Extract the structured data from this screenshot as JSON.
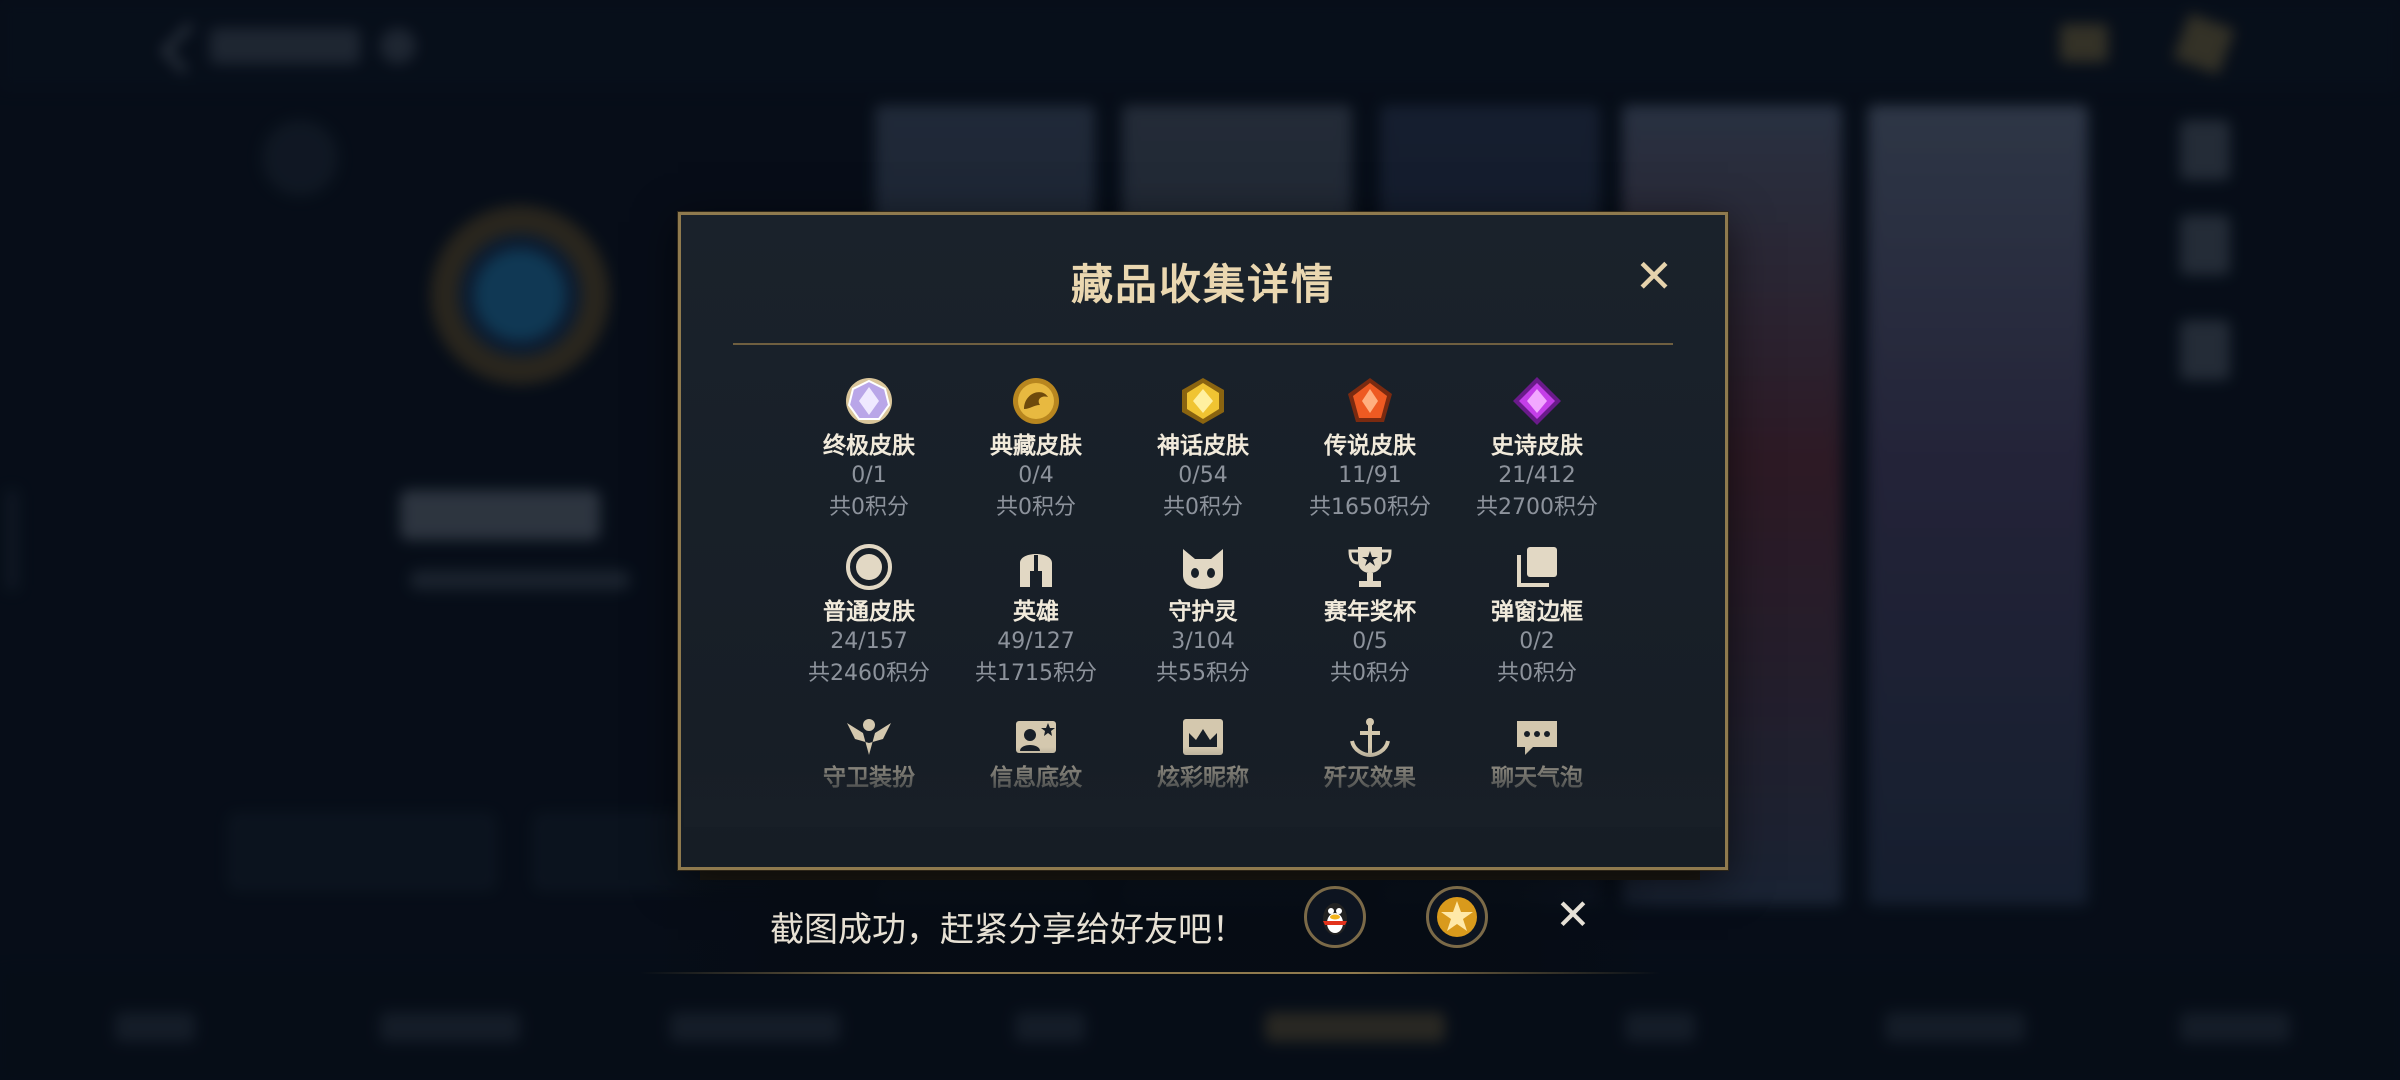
{
  "modal": {
    "title": "藏品收集详情",
    "close_icon": "close-icon",
    "rows": [
      [
        {
          "icon": "ultimate-skin-gem-icon",
          "name": "终极皮肤",
          "count": "0/1",
          "points": "共0积分"
        },
        {
          "icon": "collector-skin-dragon-icon",
          "name": "典藏皮肤",
          "count": "0/4",
          "points": "共0积分"
        },
        {
          "icon": "mythic-skin-gem-icon",
          "name": "神话皮肤",
          "count": "0/54",
          "points": "共0积分"
        },
        {
          "icon": "legend-skin-gem-icon",
          "name": "传说皮肤",
          "count": "11/91",
          "points": "共1650积分"
        },
        {
          "icon": "epic-skin-gem-icon",
          "name": "史诗皮肤",
          "count": "21/412",
          "points": "共2700积分"
        }
      ],
      [
        {
          "icon": "normal-skin-ring-icon",
          "name": "普通皮肤",
          "count": "24/157",
          "points": "共2460积分"
        },
        {
          "icon": "hero-helmet-icon",
          "name": "英雄",
          "count": "49/127",
          "points": "共1715积分"
        },
        {
          "icon": "guardian-spirit-icon",
          "name": "守护灵",
          "count": "3/104",
          "points": "共55积分"
        },
        {
          "icon": "season-trophy-icon",
          "name": "赛年奖杯",
          "count": "0/5",
          "points": "共0积分"
        },
        {
          "icon": "popup-frame-icon",
          "name": "弹窗边框",
          "count": "0/2",
          "points": "共0积分"
        }
      ],
      [
        {
          "icon": "guard-outfit-icon",
          "name": "守卫装扮"
        },
        {
          "icon": "info-background-icon",
          "name": "信息底纹"
        },
        {
          "icon": "colorful-nickname-icon",
          "name": "炫彩昵称"
        },
        {
          "icon": "annihilate-effect-icon",
          "name": "歼灭效果"
        },
        {
          "icon": "chat-bubble-icon",
          "name": "聊天气泡"
        }
      ]
    ]
  },
  "toast": {
    "message": "截图成功，赶紧分享给好友吧！",
    "share_qq_icon": "qq-penguin-icon",
    "share_favorite_icon": "star-icon",
    "close_icon": "close-icon"
  },
  "colors": {
    "gold_border": "#8f7a4e",
    "title_text": "#ead7b0",
    "panel_bg": "#181f27"
  }
}
